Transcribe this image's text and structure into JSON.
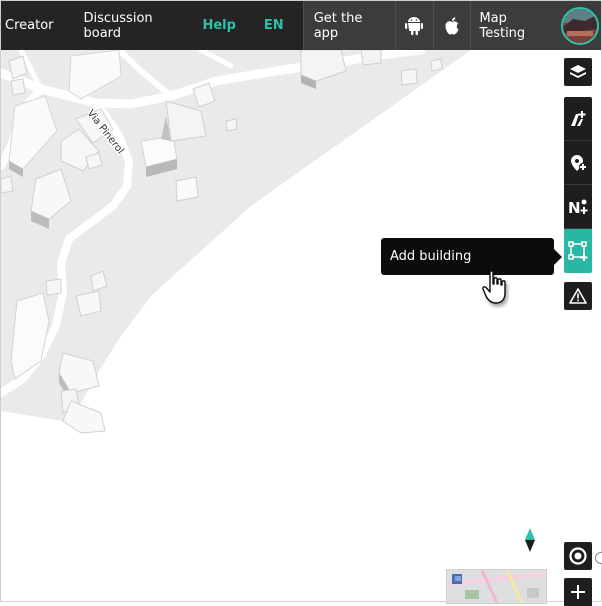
{
  "topbar": {
    "nav_creator": "Creator",
    "nav_discussion": "Discussion board",
    "nav_help": "Help",
    "nav_language": "EN",
    "get_app": "Get the app",
    "project_name": "Map Testing"
  },
  "map": {
    "street_label": "Via Pinerol"
  },
  "toolbar": {
    "tools": [
      "layers-icon",
      "add-road-icon",
      "add-point-icon",
      "add-name-icon",
      "add-building-icon"
    ],
    "active_tool": "add-building-icon",
    "report_icon": "warning-icon"
  },
  "tooltip": {
    "text": "Add building"
  },
  "colors": {
    "accent": "#2bc2a9",
    "toolbar_bg": "#1e1e1e",
    "topbar_bg": "#242424",
    "map_gray": "#e9eaeb"
  }
}
